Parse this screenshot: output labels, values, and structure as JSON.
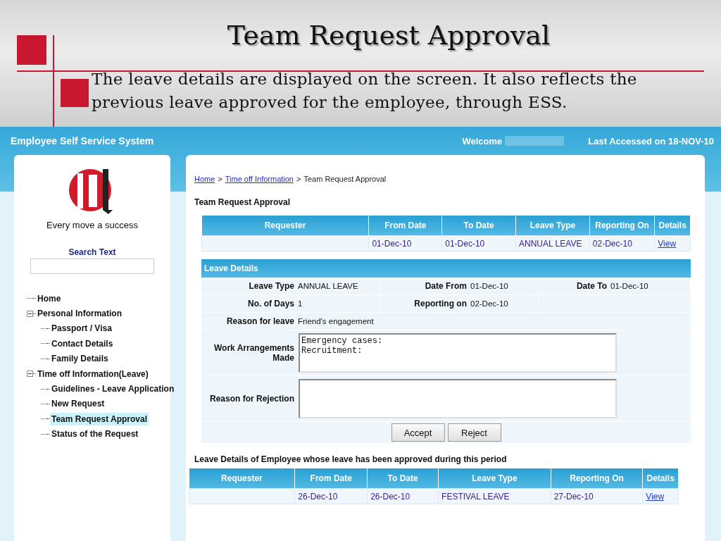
{
  "slide": {
    "title": "Team Request Approval",
    "text": "The leave details are displayed on the screen. It also reflects the previous leave approved for the employee, through ESS."
  },
  "app": {
    "header": {
      "title": "Employee Self Service System",
      "welcome": "Welcome",
      "last_accessed": "Last Accessed on 18-NOV-10"
    },
    "sidebar": {
      "tagline": "Every move a success",
      "search_label": "Search Text",
      "tree": [
        {
          "label": "Home",
          "selected": false
        },
        {
          "label": "Personal Information",
          "expanded": true,
          "selected": false,
          "children": [
            {
              "label": "Passport / Visa",
              "selected": false
            },
            {
              "label": "Contact Details",
              "selected": false
            },
            {
              "label": "Family Details",
              "selected": false
            }
          ]
        },
        {
          "label": "Time off Information(Leave)",
          "expanded": true,
          "selected": false,
          "children": [
            {
              "label": "Guidelines - Leave Application",
              "selected": false
            },
            {
              "label": "New Request",
              "selected": false
            },
            {
              "label": "Team Request Approval",
              "selected": true
            },
            {
              "label": "Status of the Request",
              "selected": false
            }
          ]
        }
      ]
    },
    "content": {
      "breadcrumb": [
        {
          "label": "Home",
          "kind": "link"
        },
        {
          "label": ">",
          "kind": "separator"
        },
        {
          "label": "Time off Information",
          "kind": "link"
        },
        {
          "label": ">",
          "kind": "separator"
        },
        {
          "label": "Team Request Approval",
          "kind": "current"
        }
      ],
      "heading": "Team Request Approval",
      "request_table": {
        "columns": [
          "Requester",
          "From Date",
          "To Date",
          "Leave Type",
          "Reporting On",
          "Details"
        ],
        "rows": [
          {
            "from_date": "01-Dec-10",
            "to_date": "01-Dec-10",
            "leave_type": "ANNUAL LEAVE",
            "reporting_on": "02-Dec-10",
            "details": "View"
          }
        ]
      },
      "leave_details": {
        "title": "Leave Details",
        "summary_rows": [
          [
            {
              "label": "Leave Type",
              "value": "ANNUAL LEAVE"
            },
            {
              "label": "Date From",
              "value": "01-Dec-10"
            },
            {
              "label": "Date To",
              "value": "01-Dec-10"
            }
          ],
          [
            {
              "label": "No. of Days",
              "value": "1"
            },
            {
              "label": "Reporting on",
              "value": "02-Dec-10"
            }
          ]
        ],
        "reason_for_leave": {
          "label": "Reason for leave",
          "value": "Friend's engagement"
        },
        "text_areas": [
          {
            "label": "Work Arrangements Made",
            "value": "Emergency cases:\nRecruitment:"
          },
          {
            "label": "Reason for Rejection"
          }
        ],
        "buttons": [
          "Accept",
          "Reject"
        ]
      },
      "approved_title": "Leave Details of Employee whose leave has been approved during this period",
      "approved_table": {
        "columns": [
          "Requester",
          "From Date",
          "To Date",
          "Leave Type",
          "Reporting On",
          "Details"
        ],
        "rows": [
          {
            "from_date": "26-Dec-10",
            "to_date": "26-Dec-10",
            "leave_type": "FESTIVAL LEAVE",
            "reporting_on": "27-Dec-10",
            "details": "View"
          }
        ]
      }
    }
  }
}
